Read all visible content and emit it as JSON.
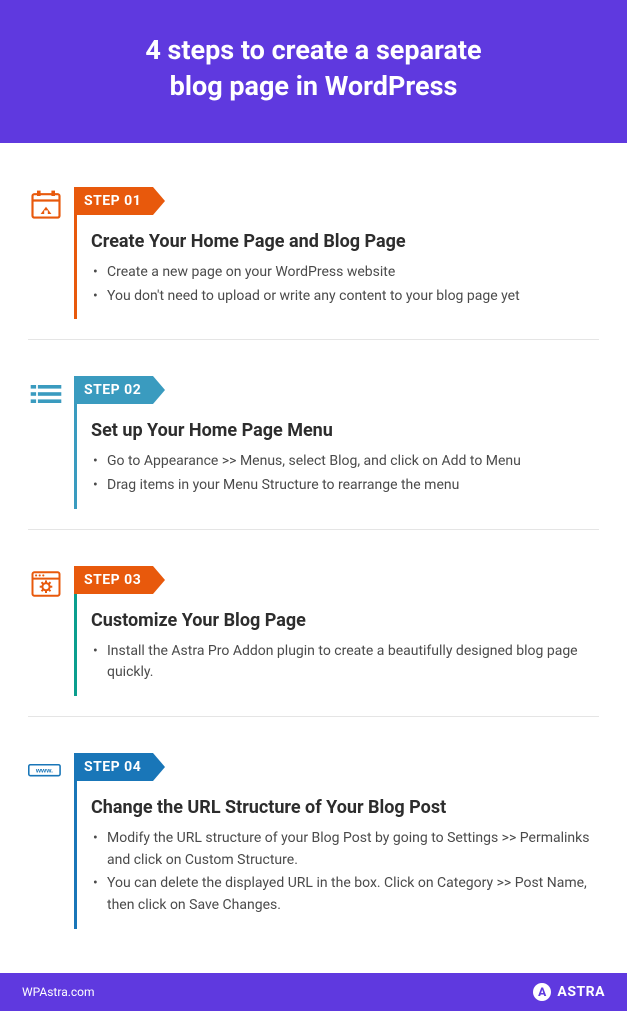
{
  "header": {
    "title_line1": "4 steps to create a separate",
    "title_line2": "blog page in WordPress"
  },
  "steps": [
    {
      "label": "STEP 01",
      "title": "Create Your Home Page and Blog Page",
      "icon": "calendar-home-icon",
      "bullets": [
        "Create a new page on your WordPress website",
        "You don't need to upload or write any content to your blog page yet"
      ]
    },
    {
      "label": "STEP 02",
      "title": "Set up Your Home Page Menu",
      "icon": "menu-list-icon",
      "bullets": [
        "Go to Appearance >> Menus, select Blog, and click on Add to Menu",
        "Drag items in your Menu Structure to rearrange the menu"
      ]
    },
    {
      "label": "STEP 03",
      "title": "Customize Your Blog Page",
      "icon": "browser-gear-icon",
      "bullets": [
        "Install the Astra Pro Addon plugin to create a beautifully designed blog page quickly."
      ]
    },
    {
      "label": "STEP 04",
      "title": "Change the URL Structure of Your Blog Post",
      "icon": "www-url-icon",
      "bullets": [
        "Modify the URL structure of your Blog Post by going to Settings >> Permalinks and click on Custom Structure.",
        "You can delete the displayed URL in the box. Click on Category >> Post Name, then click on Save Changes."
      ]
    }
  ],
  "footer": {
    "site": "WPAstra.com",
    "brand": "ASTRA"
  }
}
